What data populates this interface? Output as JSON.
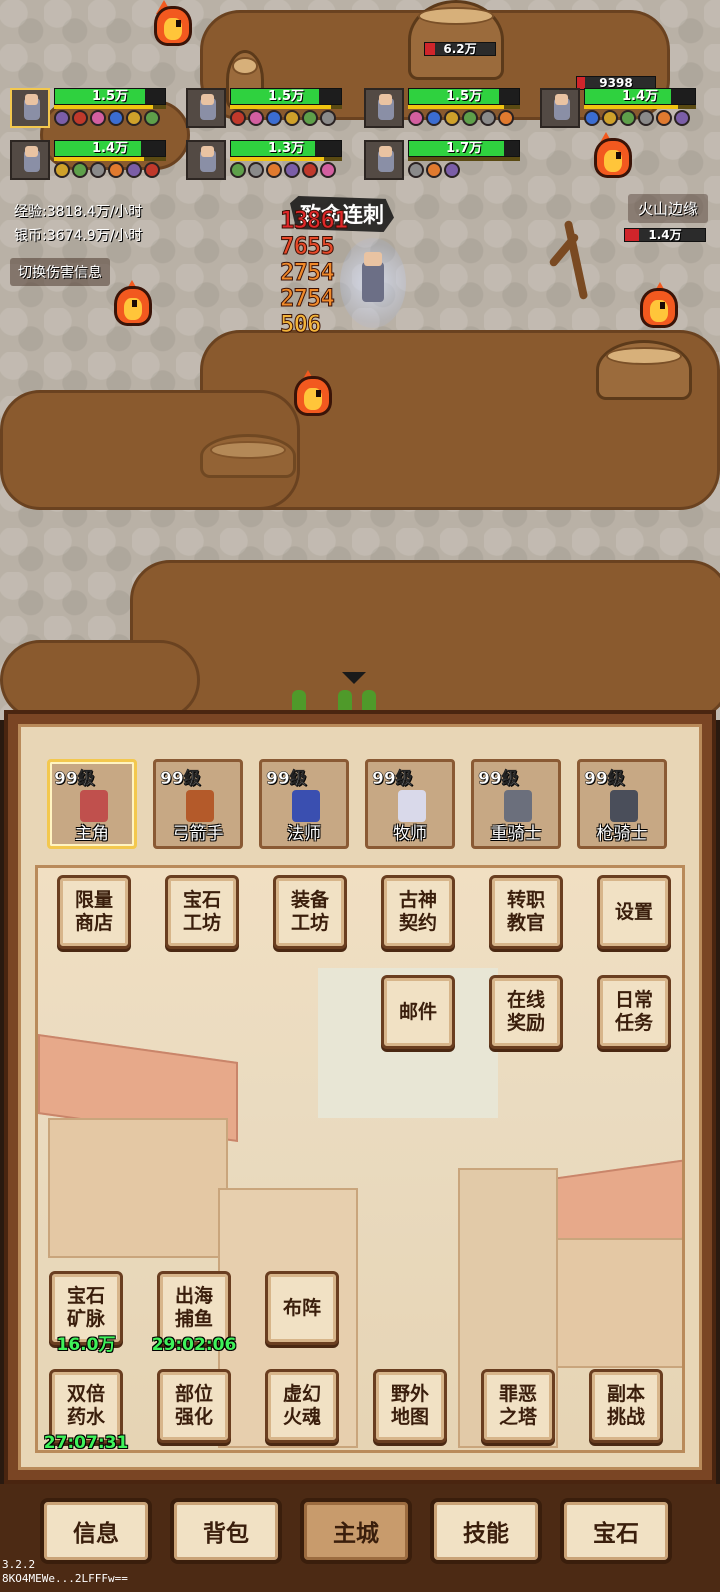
{
  "battle": {
    "party": [
      {
        "hp": "1.5万",
        "hp_pct": 0.82,
        "mp_pct": 0.88,
        "selected": true
      },
      {
        "hp": "1.5万",
        "hp_pct": 0.8,
        "mp_pct": 0.9,
        "selected": false
      },
      {
        "hp": "1.5万",
        "hp_pct": 0.82,
        "mp_pct": 0.86,
        "selected": false
      },
      {
        "hp": "1.4万",
        "hp_pct": 0.78,
        "mp_pct": 0.84,
        "selected": false
      },
      {
        "hp": "1.4万",
        "hp_pct": 0.78,
        "mp_pct": 0.8,
        "selected": false
      },
      {
        "hp": "1.3万",
        "hp_pct": 0.76,
        "mp_pct": 0.84,
        "selected": false
      },
      {
        "hp": "1.7万",
        "hp_pct": 0.86,
        "mp_pct": 0.0,
        "selected": false
      }
    ],
    "enemy_hp_top": "6.2万",
    "enemy_hp_right_top": "9398",
    "enemy_hp_right": "1.4万",
    "exp_rate": "经验:3818.4万/小时",
    "silver_rate": "银币:3674.9万/小时",
    "toggle_damage": "切换伤害信息",
    "zone": "火山边缘",
    "skill_name": "致命连刺",
    "damage_numbers": [
      "13861",
      "7655",
      "2754",
      "2754",
      "506"
    ]
  },
  "roster": [
    {
      "level": "99级",
      "name": "主角",
      "color": "#c0504d",
      "active": true
    },
    {
      "level": "99级",
      "name": "弓箭手",
      "color": "#b45a2a",
      "active": false
    },
    {
      "level": "99级",
      "name": "法师",
      "color": "#3a4fb0",
      "active": false
    },
    {
      "level": "99级",
      "name": "牧师",
      "color": "#d9d9ea",
      "active": false
    },
    {
      "level": "99级",
      "name": "重骑士",
      "color": "#6b6f7c",
      "active": false
    },
    {
      "level": "99级",
      "name": "枪骑士",
      "color": "#4a4e5a",
      "active": false
    }
  ],
  "menu": {
    "limited_shop": "限量\n商店",
    "gem_workshop": "宝石\n工坊",
    "equip_workshop": "装备\n工坊",
    "ancient_pact": "古神\n契约",
    "job_trainer": "转职\n教官",
    "settings": "设置",
    "mail": "邮件",
    "online_reward": "在线\n奖励",
    "daily_tasks": "日常\n任务",
    "gem_mine": "宝石\n矿脉",
    "gem_mine_value": "16.0万",
    "sea_fishing": "出海\n捕鱼",
    "sea_fishing_timer": "29:02:06",
    "formation": "布阵",
    "double_potion": "双倍\n药水",
    "double_potion_timer": "27:07:31",
    "part_enhance": "部位\n强化",
    "phantom_soul": "虚幻\n火魂",
    "field_map": "野外\n地图",
    "evil_tower": "罪恶\n之塔",
    "dungeon_challenge": "副本\n挑战"
  },
  "nav": {
    "info": "信息",
    "bag": "背包",
    "city": "主城",
    "skills": "技能",
    "gems": "宝石"
  },
  "version": "3.2.2",
  "device_id": "8KO4MEWe...2LFFFw=="
}
